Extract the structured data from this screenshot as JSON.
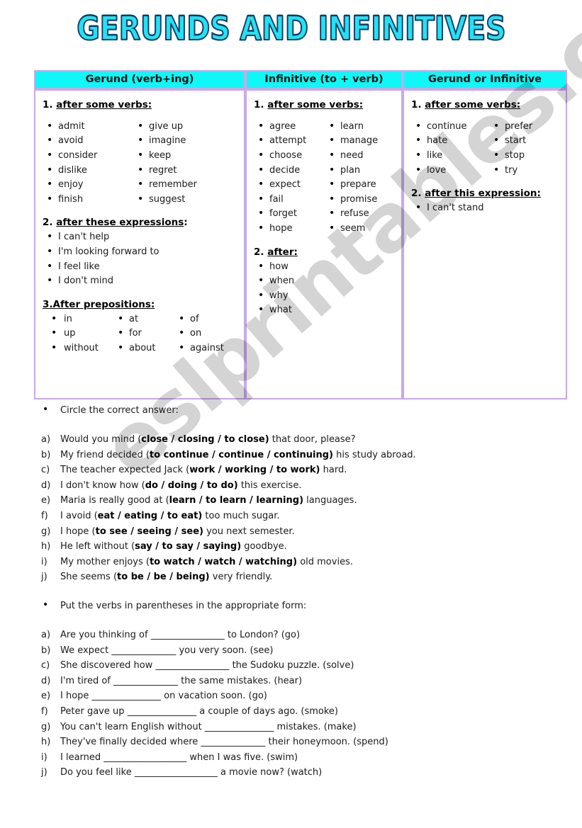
{
  "title": "GERUNDS AND INFINITIVES",
  "watermark": "eslprintables.com",
  "table": {
    "headers": [
      "Gerund (verb+ing)",
      "Infinitive (to + verb)",
      "Gerund or Infinitive"
    ],
    "columns": [
      {
        "sections": [
          {
            "number": "1.",
            "heading": "after some verbs:",
            "layout": "two-col",
            "col_a": [
              "admit",
              "avoid",
              "consider",
              "dislike",
              "enjoy",
              "finish"
            ],
            "col_b": [
              "give up",
              "imagine",
              "keep",
              "regret",
              "remember",
              "suggest"
            ]
          },
          {
            "number": "2.",
            "heading": "after these expressions",
            "suffix": ":",
            "layout": "single",
            "items": [
              "I can't help",
              "I'm looking forward to",
              "I feel like",
              "I don't mind"
            ]
          },
          {
            "number": "3.",
            "heading": "After  prepositions:",
            "layout": "three-col",
            "col_a": [
              "in",
              "up",
              "without"
            ],
            "col_b": [
              "at",
              "for",
              "about"
            ],
            "col_c": [
              "of",
              "on",
              "against"
            ]
          }
        ]
      },
      {
        "sections": [
          {
            "number": "1.",
            "heading": "after some verbs:",
            "layout": "two-col",
            "col_a": [
              "agree",
              "attempt",
              "choose",
              "decide",
              "expect",
              "fail",
              "forget",
              "hope"
            ],
            "col_b": [
              "learn",
              "manage",
              "need",
              "plan",
              "prepare",
              "promise",
              "refuse",
              "seem"
            ]
          },
          {
            "number": "2.",
            "heading": "after:",
            "layout": "single",
            "items": [
              "how",
              "when",
              "why",
              "what"
            ]
          }
        ]
      },
      {
        "sections": [
          {
            "number": "1.",
            "heading": "after some verbs:",
            "layout": "two-col",
            "col_a": [
              "continue",
              "hate",
              "like",
              "love"
            ],
            "col_b": [
              "prefer",
              "start",
              "stop",
              "try"
            ]
          },
          {
            "number": "2.",
            "heading": "after this expression:",
            "layout": "single",
            "items": [
              "I can't stand"
            ]
          }
        ]
      }
    ]
  },
  "exercise_1": {
    "instruction": "Circle the correct answer:",
    "items": [
      {
        "label": "a)",
        "before": "Would you mind (",
        "bold": "close / closing / to close)",
        "after": " that door, please?"
      },
      {
        "label": "b)",
        "before": "My friend decided (",
        "bold": "to continue / continue / continuing)",
        "after": " his study abroad."
      },
      {
        "label": "c)",
        "before": "The teacher expected Jack (",
        "bold": "work / working / to work)",
        "after": " hard."
      },
      {
        "label": "d)",
        "before": "I don't know how (",
        "bold": "do / doing / to do)",
        "after": " this exercise."
      },
      {
        "label": "e)",
        "before": "Maria is really good at (",
        "bold": "learn / to learn / learning)",
        "after": " languages."
      },
      {
        "label": "f)",
        "before": "I avoid (",
        "bold": "eat / eating / to eat)",
        "after": " too much sugar."
      },
      {
        "label": "g)",
        "before": "I hope (",
        "bold": "to see / seeing / see)",
        "after": " you next semester."
      },
      {
        "label": "h)",
        "before": "He left without (",
        "bold": "say / to say / saying)",
        "after": " goodbye."
      },
      {
        "label": "i)",
        "before": "My mother enjoys (",
        "bold": "to watch / watch / watching)",
        "after": " old movies."
      },
      {
        "label": "j)",
        "before": "She seems (",
        "bold": "to be / be / being)",
        "after": " very friendly."
      }
    ]
  },
  "exercise_2": {
    "instruction": "Put the verbs in parentheses in the appropriate form:",
    "items": [
      {
        "label": "a)",
        "before": "Are you thinking of ",
        "blank": "________________",
        "after": " to London?  (go)"
      },
      {
        "label": "b)",
        "before": "We expect ",
        "blank": "______________",
        "after": " you very soon.  (see)"
      },
      {
        "label": "c)",
        "before": "She discovered how ",
        "blank": "________________",
        "after": " the Sudoku puzzle. (solve)"
      },
      {
        "label": "d)",
        "before": "I'm tired of ",
        "blank": "______________",
        "after": " the same mistakes. (hear)"
      },
      {
        "label": "e)",
        "before": "I hope ",
        "blank": "_______________",
        "after": " on vacation soon. (go)"
      },
      {
        "label": "f)",
        "before": "Peter gave up ",
        "blank": "_______________",
        "after": " a couple of days ago. (smoke)"
      },
      {
        "label": "g)",
        "before": "You can't learn English without ",
        "blank": "_______________",
        "after": " mistakes. (make)"
      },
      {
        "label": "h)",
        "before": "They've finally decided where ",
        "blank": "______________",
        "after": " their honeymoon. (spend)"
      },
      {
        "label": "i)",
        "before": "I learned ",
        "blank": "__________________",
        "after": " when I was five. (swim)"
      },
      {
        "label": "j)",
        "before": "Do you feel like ",
        "blank": "__________________",
        "after": " a movie now? (watch)"
      }
    ]
  }
}
